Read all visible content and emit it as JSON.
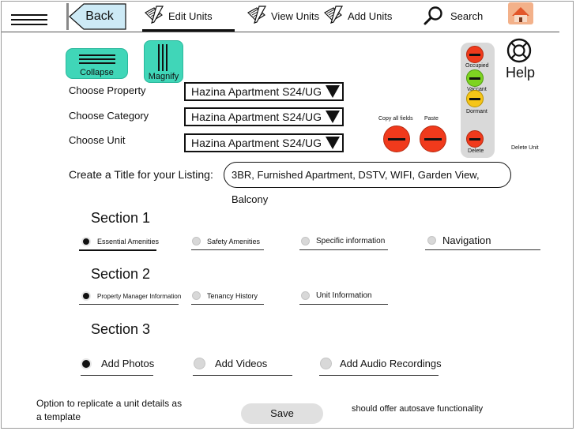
{
  "topbar": {
    "back_label": "Back",
    "nav": [
      {
        "label": "Edit Units",
        "icon": "edit-pencil-icon"
      },
      {
        "label": "View Units",
        "icon": "edit-pencil-icon"
      },
      {
        "label": "Add Units",
        "icon": "edit-pencil-icon"
      },
      {
        "label": "Search",
        "icon": "search-icon"
      }
    ]
  },
  "tools": {
    "collapse_label": "Collapse",
    "magnify_label": "Magnify",
    "help_label": "Help"
  },
  "form": {
    "property_label": "Choose Property",
    "category_label": "Choose Category",
    "unit_label": "Choose Unit",
    "property_value": "Hazina Apartment S24/UG",
    "category_value": "Hazina Apartment S24/UG",
    "unit_value": "Hazina Apartment S24/UG",
    "title_label": "Create a Title for your Listing:",
    "title_value": "3BR, Furnished Apartment, DSTV, WIFI, Garden View, Balcony"
  },
  "actions": {
    "copy_label": "Copy all fields",
    "paste_label": "Paste",
    "delete_unit_label": "Delete Unit"
  },
  "status": {
    "occupied": "Occupied",
    "vaccant": "Vaccant",
    "dormant": "Dormant",
    "delete": "Delete",
    "colors": {
      "occupied": "#f03a1c",
      "vaccant": "#7ed321",
      "dormant": "#f5c518",
      "delete": "#f03a1c"
    }
  },
  "sections": {
    "s1": {
      "title": "Section 1",
      "options": [
        "Essential Amenities",
        "Safety Amenities",
        "Specific information",
        "Navigation"
      ],
      "selected": 0
    },
    "s2": {
      "title": "Section 2",
      "options": [
        "Property Manager Information",
        "Tenancy History",
        "Unit Information"
      ],
      "selected": 0
    },
    "s3": {
      "title": "Section 3",
      "options": [
        "Add Photos",
        "Add Videos",
        "Add Audio Recordings"
      ],
      "selected": 0
    }
  },
  "footer": {
    "note_left_1": "Option to replicate a unit details as",
    "note_left_2": "a template",
    "save_label": "Save",
    "note_right": "should offer autosave functionality"
  },
  "accent": "#40d6b8"
}
